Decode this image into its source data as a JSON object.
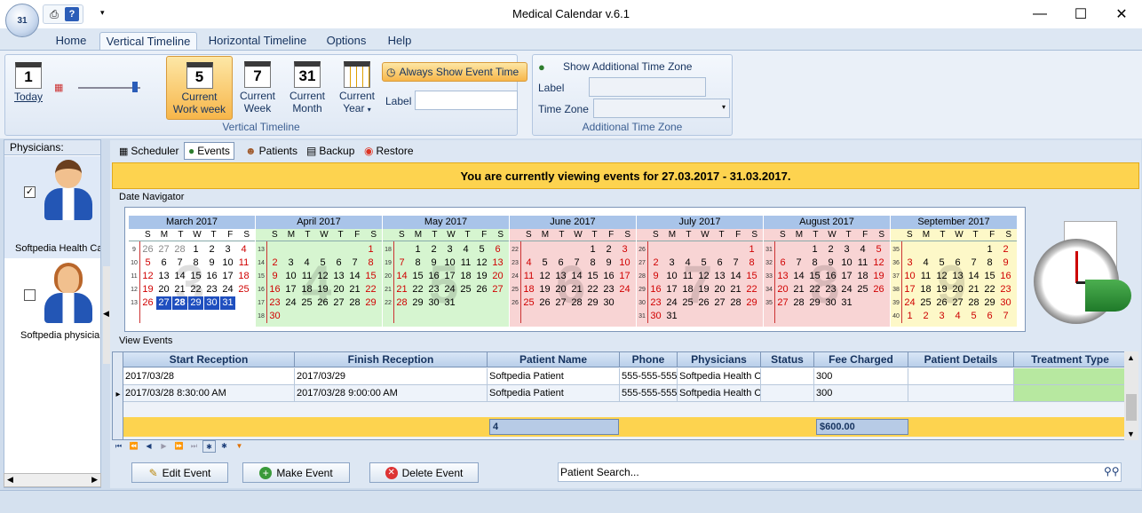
{
  "window": {
    "title": "Medical Calendar v.6.1",
    "app_button_text": "31"
  },
  "ribbon_tabs": [
    "Home",
    "Vertical Timeline",
    "Horizontal Timeline",
    "Options",
    "Help"
  ],
  "vertical_timeline": {
    "group_label": "Vertical Timeline",
    "today": {
      "label": "Today",
      "icon_num": "1"
    },
    "current_work_week": {
      "label1": "Current",
      "label2": "Work week",
      "icon_num": "5"
    },
    "current_week": {
      "label1": "Current",
      "label2": "Week",
      "icon_num": "7"
    },
    "current_month": {
      "label1": "Current",
      "label2": "Month",
      "icon_num": "31"
    },
    "current_year": {
      "label1": "Current",
      "label2": "Year"
    },
    "always_show_event_time": "Always Show Event Time",
    "label_caption": "Label",
    "label_value": ""
  },
  "additional_tz": {
    "group_label": "Additional Time Zone",
    "show_label": "Show Additional Time Zone",
    "label_caption": "Label",
    "tz_caption": "Time Zone",
    "label_value": "",
    "tz_value": ""
  },
  "physicians": {
    "header": "Physicians:",
    "items": [
      {
        "name": "Softpedia Health Ca",
        "checked": true,
        "check_mark": "✓"
      },
      {
        "name": "Softpedia physicia",
        "checked": false,
        "check_mark": ""
      }
    ]
  },
  "subtabs": [
    "Scheduler",
    "Events",
    "Patients",
    "Backup",
    "Restore"
  ],
  "banner": "You are currently viewing events for 27.03.2017 - 31.03.2017.",
  "date_navigator_label": "Date Navigator",
  "months": [
    {
      "title": "March 2017",
      "bg": "#ffffff",
      "watermark": "3",
      "weeks": [
        "9",
        "10",
        "11",
        "12",
        "13"
      ],
      "days": [
        [
          "26",
          "27",
          "28",
          "1",
          "2",
          "3",
          "4"
        ],
        [
          "5",
          "6",
          "7",
          "8",
          "9",
          "10",
          "11"
        ],
        [
          "12",
          "13",
          "14",
          "15",
          "16",
          "17",
          "18"
        ],
        [
          "19",
          "20",
          "21",
          "22",
          "23",
          "24",
          "25"
        ],
        [
          "26",
          "27",
          "28",
          "29",
          "30",
          "31",
          ""
        ]
      ]
    },
    {
      "title": "April 2017",
      "bg": "#d6f5d0",
      "watermark": "4",
      "weeks": [
        "13",
        "14",
        "15",
        "16",
        "17",
        "18"
      ],
      "days": [
        [
          "",
          "",
          "",
          "",
          "",
          "",
          "1"
        ],
        [
          "2",
          "3",
          "4",
          "5",
          "6",
          "7",
          "8"
        ],
        [
          "9",
          "10",
          "11",
          "12",
          "13",
          "14",
          "15"
        ],
        [
          "16",
          "17",
          "18",
          "19",
          "20",
          "21",
          "22"
        ],
        [
          "23",
          "24",
          "25",
          "26",
          "27",
          "28",
          "29"
        ],
        [
          "30",
          "",
          "",
          "",
          "",
          "",
          ""
        ]
      ]
    },
    {
      "title": "May 2017",
      "bg": "#d6f5d0",
      "watermark": "5",
      "weeks": [
        "18",
        "19",
        "20",
        "21",
        "22"
      ],
      "days": [
        [
          "",
          "1",
          "2",
          "3",
          "4",
          "5",
          "6"
        ],
        [
          "7",
          "8",
          "9",
          "10",
          "11",
          "12",
          "13"
        ],
        [
          "14",
          "15",
          "16",
          "17",
          "18",
          "19",
          "20"
        ],
        [
          "21",
          "22",
          "23",
          "24",
          "25",
          "26",
          "27"
        ],
        [
          "28",
          "29",
          "30",
          "31",
          "",
          "",
          ""
        ]
      ]
    },
    {
      "title": "June 2017",
      "bg": "#f8d4d4",
      "watermark": "6",
      "weeks": [
        "22",
        "23",
        "24",
        "25",
        "26"
      ],
      "days": [
        [
          "",
          "",
          "",
          "",
          "1",
          "2",
          "3"
        ],
        [
          "4",
          "5",
          "6",
          "7",
          "8",
          "9",
          "10"
        ],
        [
          "11",
          "12",
          "13",
          "14",
          "15",
          "16",
          "17"
        ],
        [
          "18",
          "19",
          "20",
          "21",
          "22",
          "23",
          "24"
        ],
        [
          "25",
          "26",
          "27",
          "28",
          "29",
          "30",
          ""
        ]
      ]
    },
    {
      "title": "July 2017",
      "bg": "#f8d4d4",
      "watermark": "7",
      "weeks": [
        "26",
        "27",
        "28",
        "29",
        "30",
        "31"
      ],
      "days": [
        [
          "",
          "",
          "",
          "",
          "",
          "",
          "1"
        ],
        [
          "2",
          "3",
          "4",
          "5",
          "6",
          "7",
          "8"
        ],
        [
          "9",
          "10",
          "11",
          "12",
          "13",
          "14",
          "15"
        ],
        [
          "16",
          "17",
          "18",
          "19",
          "20",
          "21",
          "22"
        ],
        [
          "23",
          "24",
          "25",
          "26",
          "27",
          "28",
          "29"
        ],
        [
          "30",
          "31",
          "",
          "",
          "",
          "",
          ""
        ]
      ]
    },
    {
      "title": "August 2017",
      "bg": "#f8d4d4",
      "watermark": "8",
      "weeks": [
        "31",
        "32",
        "33",
        "34",
        "35"
      ],
      "days": [
        [
          "",
          "",
          "1",
          "2",
          "3",
          "4",
          "5"
        ],
        [
          "6",
          "7",
          "8",
          "9",
          "10",
          "11",
          "12"
        ],
        [
          "13",
          "14",
          "15",
          "16",
          "17",
          "18",
          "19"
        ],
        [
          "20",
          "21",
          "22",
          "23",
          "24",
          "25",
          "26"
        ],
        [
          "27",
          "28",
          "29",
          "30",
          "31",
          "",
          ""
        ]
      ]
    },
    {
      "title": "September 2017",
      "bg": "#fdf8c8",
      "watermark": "9",
      "weeks": [
        "35",
        "36",
        "37",
        "38",
        "39",
        "40"
      ],
      "days": [
        [
          "",
          "",
          "",
          "",
          "",
          "1",
          "2"
        ],
        [
          "3",
          "4",
          "5",
          "6",
          "7",
          "8",
          "9"
        ],
        [
          "10",
          "11",
          "12",
          "13",
          "14",
          "15",
          "16"
        ],
        [
          "17",
          "18",
          "19",
          "20",
          "21",
          "22",
          "23"
        ],
        [
          "24",
          "25",
          "26",
          "27",
          "28",
          "29",
          "30"
        ],
        [
          "1",
          "2",
          "3",
          "4",
          "5",
          "6",
          "7"
        ]
      ]
    }
  ],
  "dow": [
    "S",
    "M",
    "T",
    "W",
    "T",
    "F",
    "S"
  ],
  "view_events_label": "View Events",
  "grid": {
    "columns": [
      "Start Reception",
      "Finish Reception",
      "Patient Name",
      "Phone",
      "Physicians",
      "Status",
      "Fee Charged",
      "Patient Details",
      "Treatment Type"
    ],
    "rows": [
      [
        "2017/03/28",
        "2017/03/29",
        "Softpedia Patient",
        "555-555-555",
        "Softpedia Health C",
        "",
        "300",
        "",
        ""
      ],
      [
        "2017/03/28 8:30:00 AM",
        "2017/03/28 9:00:00 AM",
        "Softpedia Patient",
        "555-555-555",
        "Softpedia Health C",
        "",
        "300",
        "",
        ""
      ]
    ],
    "summary_count": "4",
    "summary_fee": "$600.00",
    "row_indicator": "▸"
  },
  "actions": {
    "edit": "Edit Event",
    "make": "Make Event",
    "delete": "Delete Event",
    "search_placeholder": "Patient Search..."
  }
}
